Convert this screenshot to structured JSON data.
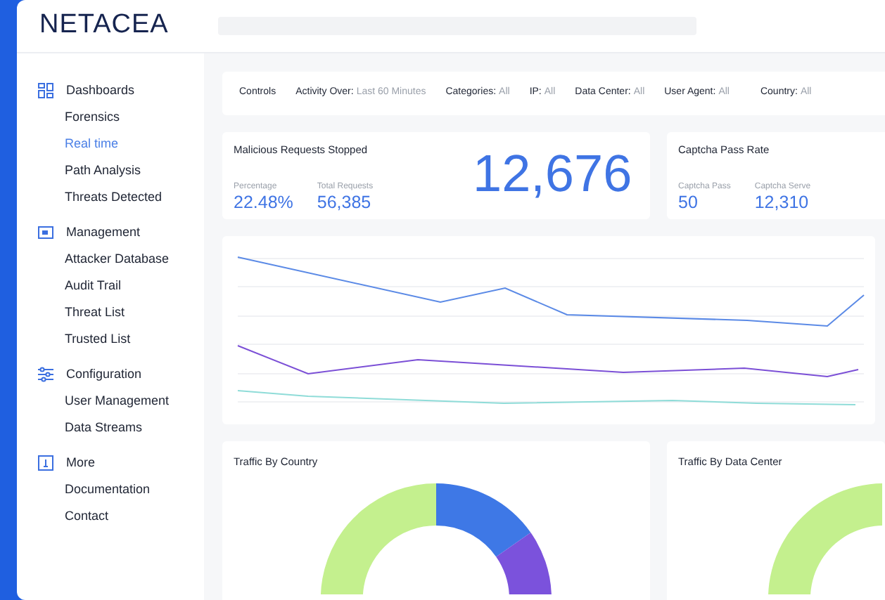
{
  "logo": "NETACEA",
  "sidebar": {
    "sections": [
      {
        "kind": "dashboards",
        "title": "Dashboards",
        "items": [
          {
            "label": "Forensics",
            "selected": false
          },
          {
            "label": "Real time",
            "selected": true
          },
          {
            "label": "Path Analysis",
            "selected": false
          },
          {
            "label": "Threats Detected",
            "selected": false
          }
        ]
      },
      {
        "kind": "management",
        "title": "Management",
        "items": [
          {
            "label": "Attacker Database",
            "selected": false
          },
          {
            "label": "Audit Trail",
            "selected": false
          },
          {
            "label": "Threat List",
            "selected": false
          },
          {
            "label": "Trusted List",
            "selected": false
          }
        ]
      },
      {
        "kind": "configuration",
        "title": "Configuration",
        "items": [
          {
            "label": "User Management",
            "selected": false
          },
          {
            "label": "Data Streams",
            "selected": false
          }
        ]
      },
      {
        "kind": "more",
        "title": "More",
        "items": [
          {
            "label": "Documentation",
            "selected": false
          },
          {
            "label": "Contact",
            "selected": false
          }
        ]
      }
    ]
  },
  "controls": {
    "title": "Controls",
    "filters": [
      {
        "label": "Activity Over:",
        "value": "Last 60 Minutes"
      },
      {
        "label": "Categories:",
        "value": "All"
      },
      {
        "label": "IP:",
        "value": "All"
      },
      {
        "label": "Data Center:",
        "value": "All"
      },
      {
        "label": "User Agent:",
        "value": "All"
      },
      {
        "label": "Country:",
        "value": "All"
      }
    ]
  },
  "malicious_card": {
    "title": "Malicious Requests Stopped",
    "stats": [
      {
        "label": "Percentage",
        "value": "22.48%"
      },
      {
        "label": "Total Requests",
        "value": "56,385"
      }
    ],
    "big_number": "12,676"
  },
  "captcha_card": {
    "title": "Captcha Pass Rate",
    "stats": [
      {
        "label": "Captcha Pass",
        "value": "50"
      },
      {
        "label": "Captcha Serve",
        "value": "12,310"
      }
    ]
  },
  "traffic_cards": [
    {
      "title": "Traffic By Country",
      "kind": "country"
    },
    {
      "title": "Traffic By Data Center",
      "kind": "datacenter"
    }
  ]
}
